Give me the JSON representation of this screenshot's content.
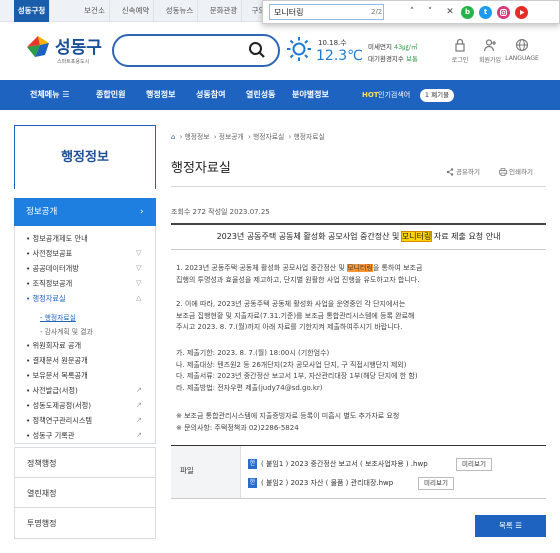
{
  "topbar": {
    "tabs": [
      "성동구청",
      "보건소",
      "신속예약",
      "성동뉴스",
      "문화관광",
      "구의"
    ]
  },
  "findbar": {
    "query": "모니터링",
    "count": "2/2",
    "up": "˄",
    "down": "˅",
    "close": "✕"
  },
  "sns": [
    "b",
    "t",
    "",
    ""
  ],
  "header": {
    "logo": "성동구",
    "logo_sub": "스마트포용도시",
    "weather_date": "10.18.수",
    "weather_temp": "12.3℃",
    "air_label": "미세먼지",
    "air_value": "43㎍/㎥",
    "aqi_label": "대기환경지수",
    "aqi_value": "보통",
    "util": [
      "로그인",
      "회원가입",
      "LANGUAGE"
    ]
  },
  "gnb": {
    "all_menu": "전체메뉴",
    "all_icon": "☰",
    "items": [
      "종합민원",
      "행정정보",
      "성동참여",
      "열린성동",
      "분야별정보"
    ],
    "hot_label": "HOT",
    "hot_text": "인기검색어",
    "hot_pill": "1 폐기물"
  },
  "sidebar": {
    "title": "행정정보",
    "active": "정보공개",
    "active_arrow": "›",
    "subs": [
      {
        "label": "정보공개제도 안내",
        "mark": ""
      },
      {
        "label": "사전정보공표",
        "mark": "▽"
      },
      {
        "label": "공공데이터개방",
        "mark": "▽"
      },
      {
        "label": "조직정보공개",
        "mark": "▽"
      },
      {
        "label": "행정자료실",
        "mark": "△"
      }
    ],
    "thirds": [
      "행정자료실",
      "감사계획 및 결과"
    ],
    "subs2": [
      {
        "label": "위원회자료 공개",
        "mark": ""
      },
      {
        "label": "결재문서 원문공개",
        "mark": ""
      },
      {
        "label": "보유문서 목록공개",
        "mark": ""
      },
      {
        "label": "사전발급(서정)",
        "mark": "↗"
      },
      {
        "label": "성동도제공정(서정)",
        "mark": "↗"
      },
      {
        "label": "정책연구관리시스템",
        "mark": "↗"
      },
      {
        "label": "성동구 기록관",
        "mark": "↗"
      }
    ],
    "mains": [
      "정책행정",
      "열린재정",
      "투명행정"
    ]
  },
  "content": {
    "breadcrumb": [
      "⌂",
      "행정정보",
      "정보공개",
      "행정자료실",
      "행정자료실"
    ],
    "title": "행정자료실",
    "share": "공유하기",
    "print": "인쇄하기",
    "meta": "조회수 272 작성일 2023.07.25",
    "article_title_pre": "2023년 공동주택 공동체 활성화 공모사업 중간정산 및 ",
    "article_title_hl": "모니터링",
    "article_title_post": " 자료 제출 요청 안내",
    "p1a": "1. 2023년 공동주택 공동체 활성화 공모사업 중간정산 및 ",
    "p1hl": "모니터링",
    "p1b": "을 통하여 보조금",
    "p1c": "집행의 투명성과 효율성을 제고하고, 단지별 원활한 사업 진행을 유도하고자 합니다.",
    "p2a": "2. 이에 따라, 2023년 공동주택 공동체 활성화 사업을 운영중인 각 단지에서는",
    "p2b": "보조금 집행현황 및 지출자료(7.31.기준)를 보조금 통합관리시스템에 등록 완료해",
    "p2c": "주시고 2023. 8. 7.(월)까지 아래 자료를 기한지켜 제출하여주시기 바랍니다.",
    "ga": "가. 제출기한: 2023. 8. 7.(월) 18:00시 (기한엄수)",
    "na": "나. 제출대상: 텐즈원2 등 26개단지(2차 공모사업 단지, 구 직접시행단지 제외)",
    "da": "다. 제출서류: 2023년 중간정산 보고서 1부, 자산관리대장 1부(해당 단지에 한 함)",
    "ra": "라. 제출방법: 전자우편 제출(judy74@sd.go.kr)",
    "note1": "※ 보조금 통합관리시스템에 지출증빙자료 등록이 미흡시 별도 추가자료 요청",
    "note2": "※ 문의사항: 주택정책과 02)2286-5824",
    "file_label": "파일",
    "files": [
      {
        "name": "( 붙임1 ) 2023 중간정산 보고서 ( 보조사업자용 ) .hwp",
        "btn": "미리보기"
      },
      {
        "name": "( 붙임2 ) 2023 자산 ( 물품 ) 관리대장.hwp",
        "btn": "미리보기"
      }
    ],
    "file_icon": "한",
    "list_btn": "목록 ☰"
  }
}
